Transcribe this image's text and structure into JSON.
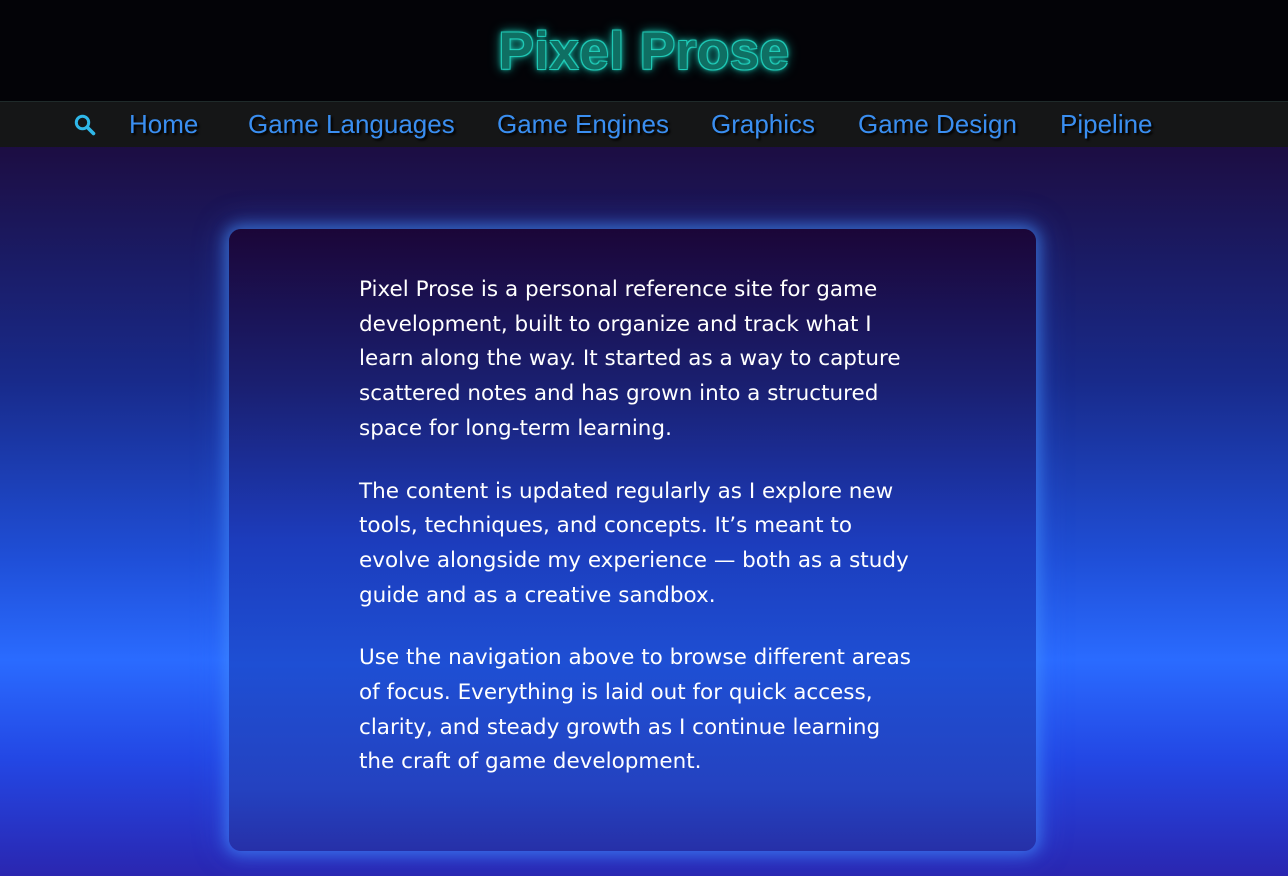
{
  "header": {
    "title": "Pixel Prose",
    "title_color": "#1bbfae"
  },
  "nav": {
    "search_icon": "search-icon",
    "items": [
      {
        "label": "Home"
      },
      {
        "label": "Game Languages"
      },
      {
        "label": "Game Engines"
      },
      {
        "label": "Graphics"
      },
      {
        "label": "Game Design"
      },
      {
        "label": "Pipeline"
      }
    ],
    "link_color": "#3a8ef0",
    "icon_color": "#2fb7e8"
  },
  "intro": {
    "paragraphs": [
      "Pixel Prose is a personal reference site for game development, built to organize and track what I learn along the way. It started as a way to capture scattered notes and has grown into a structured space for long-term learning.",
      "The content is updated regularly as I explore new tools, techniques, and concepts. It’s meant to evolve alongside my experience — both as a study guide and as a creative sandbox.",
      "Use the navigation above to browse different areas of focus. Everything is laid out for quick access, clarity, and steady growth as I continue learning the craft of game development."
    ]
  }
}
